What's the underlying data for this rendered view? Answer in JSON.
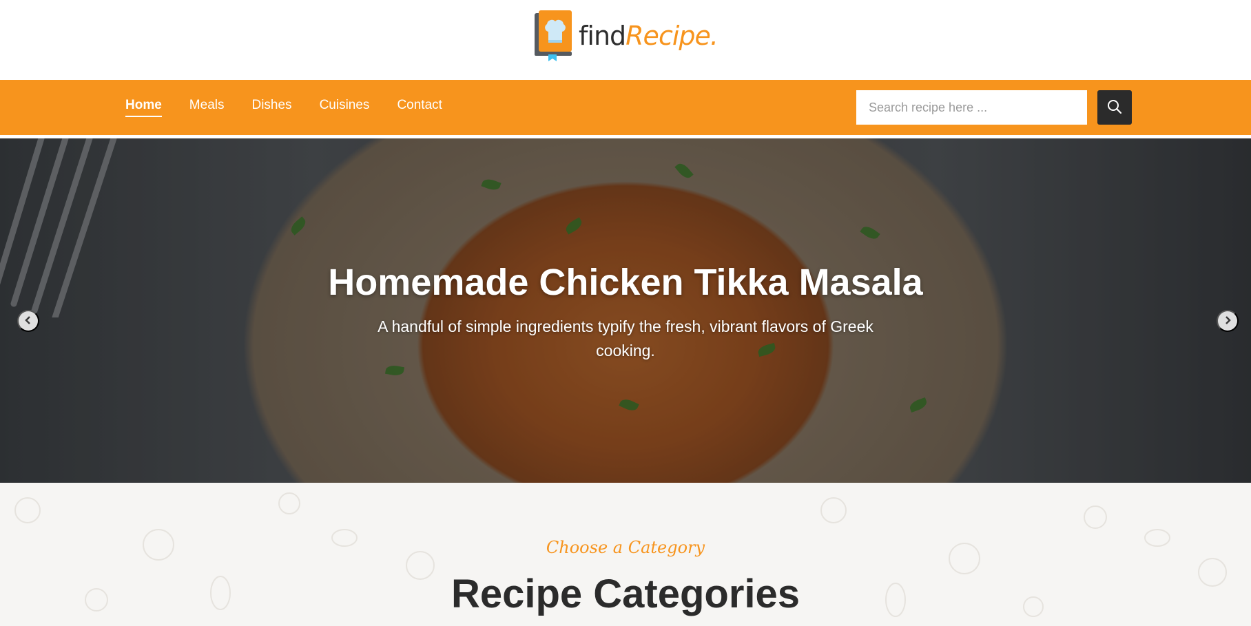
{
  "brand": {
    "name_part1": "find",
    "name_part2": "Recipe."
  },
  "nav": {
    "links": [
      {
        "label": "Home",
        "active": true
      },
      {
        "label": "Meals",
        "active": false
      },
      {
        "label": "Dishes",
        "active": false
      },
      {
        "label": "Cuisines",
        "active": false
      },
      {
        "label": "Contact",
        "active": false
      }
    ],
    "search_placeholder": "Search recipe here ...",
    "search_icon": "search-icon"
  },
  "hero": {
    "title": "Homemade Chicken Tikka Masala",
    "subtitle": "A handful of simple ingredients typify the fresh, vibrant flavors of Greek cooking.",
    "prev_icon": "chevron-left-icon",
    "next_icon": "chevron-right-icon"
  },
  "categories": {
    "eyebrow": "Choose a Category",
    "title": "Recipe Categories"
  },
  "colors": {
    "accent": "#f7941d",
    "dark": "#2b2b2b",
    "white": "#ffffff"
  }
}
